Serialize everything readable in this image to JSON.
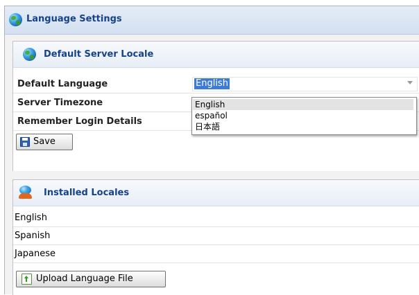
{
  "window": {
    "title": "Language Settings"
  },
  "server_locale": {
    "title": "Default Server Locale",
    "fields": {
      "default_language": "Default Language",
      "server_timezone": "Server Timezone",
      "remember_login": "Remember Login Details"
    },
    "language_select": {
      "value": "English",
      "options": [
        "English",
        "español",
        "日本語"
      ],
      "highlighted": "English"
    },
    "save_label": "Save"
  },
  "installed_locales": {
    "title": "Installed Locales",
    "items": [
      "English",
      "Spanish",
      "Japanese"
    ],
    "upload_label": "Upload Language File"
  },
  "icons": {
    "window": "globe-icon",
    "server_locale": "globe-icon",
    "installed_locales": "user-globe-icon",
    "save": "floppy-disk-icon",
    "upload": "upload-file-icon"
  },
  "colors": {
    "title_text": "#15428b",
    "selection_highlight": "#3d7bd6",
    "title_bar": "#dbe5f3"
  }
}
